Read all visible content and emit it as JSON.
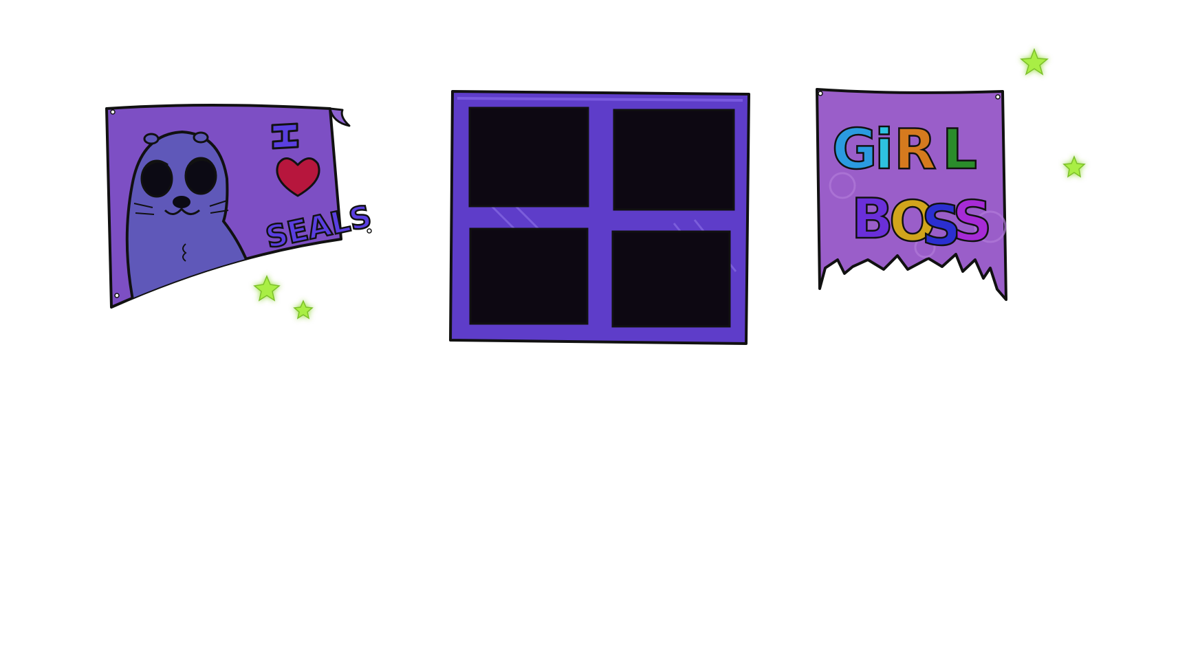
{
  "scene": {
    "background": "#ffffff",
    "wall_items": [
      {
        "id": "seal-poster",
        "kind": "poster",
        "lines": [
          "I",
          "SEALS"
        ],
        "heart": true,
        "colors": {
          "paper": "#7d4fc4",
          "seal": "#5f58b9",
          "heart": "#b7163d",
          "letters": "#5a3fe0"
        }
      },
      {
        "id": "window",
        "kind": "window",
        "panes": 4,
        "colors": {
          "frame": "#5e3dc9",
          "glass": "#0d0812"
        }
      },
      {
        "id": "girlboss-poster",
        "kind": "poster",
        "lines": [
          "GiRL",
          "BOSS"
        ],
        "torn": true,
        "colors": {
          "paper": "#9a5ec9",
          "letter_colors": [
            "#2b9be0",
            "#2ec3e0",
            "#d13b3b",
            "#d57a1e",
            "#2b8c2b",
            "#6a2fd9",
            "#2f7be5",
            "#d1a51c",
            "#2b2fd0",
            "#a62bd6",
            "#d03f9f"
          ]
        }
      }
    ],
    "stars": {
      "count": 4,
      "color": "#a9ee45",
      "glow": "#e9ffb0"
    }
  }
}
